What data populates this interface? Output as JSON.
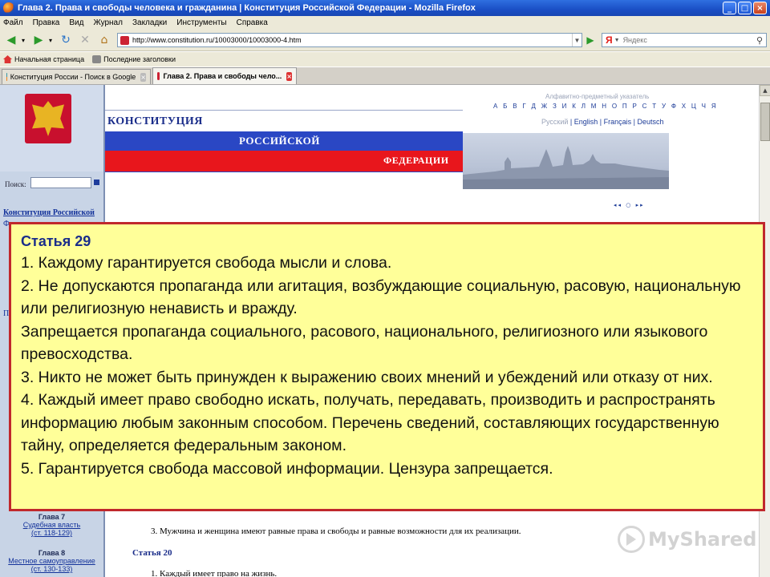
{
  "window": {
    "title": "Глава 2. Права и свободы человека и гражданина | Конституция Российской Федерации - Mozilla Firefox",
    "min": "_",
    "max": "□",
    "close": "×"
  },
  "menu": [
    "Файл",
    "Правка",
    "Вид",
    "Журнал",
    "Закладки",
    "Инструменты",
    "Справка"
  ],
  "nav": {
    "url": "http://www.constitution.ru/10003000/10003000-4.htm",
    "search_engine": "Я",
    "search_placeholder": "Яндекс"
  },
  "bookmarks": [
    "Начальная страница",
    "Последние заголовки"
  ],
  "tabs": [
    {
      "label": "Конституция России - Поиск в Google",
      "active": false
    },
    {
      "label": "Глава 2. Права и свободы чело...",
      "active": true
    }
  ],
  "site": {
    "banner": [
      "КОНСТИТУЦИЯ",
      "РОССИЙСКОЙ",
      "ФЕДЕРАЦИИ"
    ],
    "alpha_title": "Алфавитно-предметный указатель",
    "alpha_letters": "А Б В Г Д Ж З И К Л М Н О П Р С Т У Ф Х Ц Ч Я",
    "languages": {
      "current": "Русский",
      "others": "| English | Français | Deutsch"
    },
    "pager": "◂◂ ○ ▸▸",
    "search_label": "Поиск:",
    "left_link": "Конституция Российской",
    "left_frag_1": "Ф",
    "left_frag_2": "П",
    "chapters": [
      {
        "title": "Глава 7",
        "link1": "Судебная власть",
        "link2": "(ст. 118-129)"
      },
      {
        "title": "Глава 8",
        "link1": "Местное самоуправление",
        "link2": "(ст. 130-133)"
      }
    ],
    "body_line_1": "3. Мужчина и женщина имеют равные права и свободы и равные возможности для их реализации.",
    "article_20": "Статья 20",
    "body_line_2": "1. Каждый имеет право на жизнь."
  },
  "overlay": {
    "title": "Статья 29",
    "paragraphs": [
      "1. Каждому гарантируется свобода мысли и слова.",
      "2. Не допускаются пропаганда или агитация, возбуждающие социальную, расовую, национальную или религиозную ненависть и вражду.",
      "Запрещается пропаганда социального, расового, национального, религиозного или языкового превосходства.",
      "3. Никто не может быть принужден к выражению своих мнений и убеждений или отказу от них.",
      "4. Каждый имеет право свободно искать, получать, передавать, производить и распространять информацию любым законным способом. Перечень сведений, составляющих государственную тайну, определяется федеральным законом.",
      "5. Гарантируется свобода массовой информации. Цензура запрещается."
    ]
  },
  "watermark": "MyShared"
}
